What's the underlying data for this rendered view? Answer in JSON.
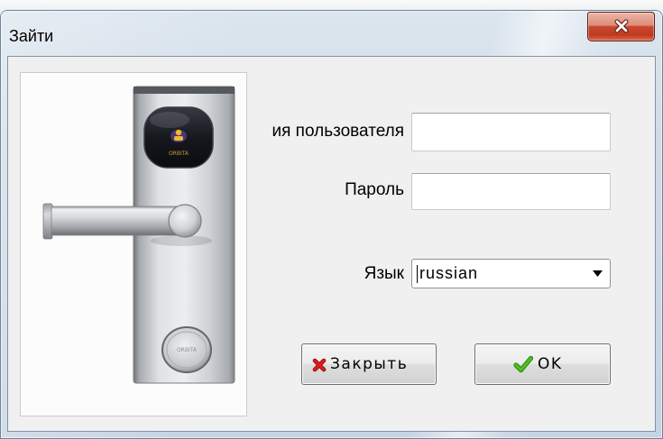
{
  "window": {
    "title": "Зайти"
  },
  "image_panel": {
    "brand": "ORBITA"
  },
  "form": {
    "username": {
      "label": "ия пользователя",
      "value": ""
    },
    "password": {
      "label": "Пароль",
      "value": ""
    },
    "language": {
      "label": "Язык",
      "value": "russian"
    }
  },
  "buttons": {
    "close": {
      "label": "Закрыть",
      "icon": "red-x-icon"
    },
    "ok": {
      "label": "OK",
      "icon": "green-checkmark-icon"
    }
  },
  "icons": {
    "window_close": "close-icon",
    "language_dropdown": "chevron-down-icon"
  },
  "colors": {
    "window_frame": "#c9d7e6",
    "dialog_background": "#f0f0f0",
    "close_button_red": "#c9432a",
    "close_x_red": "#d01515",
    "ok_check_green": "#3c9e1c"
  }
}
